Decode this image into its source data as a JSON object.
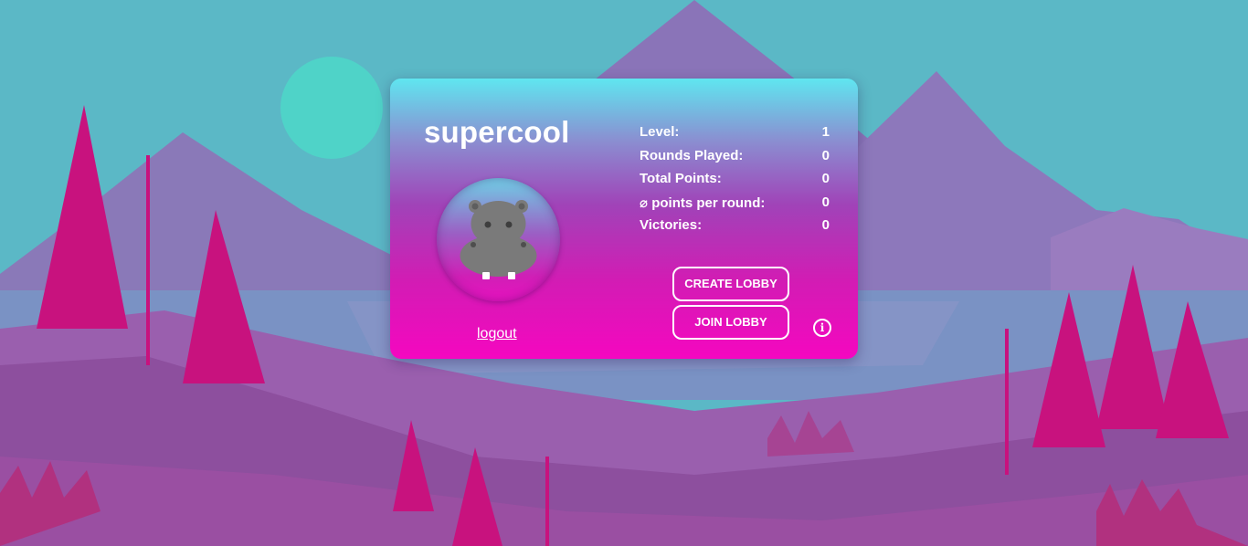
{
  "profile": {
    "username": "supercool",
    "avatar_icon": "hippo-icon",
    "logout_label": "logout"
  },
  "stats": [
    {
      "label": "Level:",
      "value": "1"
    },
    {
      "label": "Rounds Played:",
      "value": "0"
    },
    {
      "label": "Total Points:",
      "value": "0"
    },
    {
      "label": "⌀ points per round:",
      "value": "0"
    },
    {
      "label": "Victories:",
      "value": "0"
    }
  ],
  "actions": {
    "create_lobby_label": "CREATE LOBBY",
    "join_lobby_label": "JOIN LOBBY",
    "info_icon": "info-icon",
    "info_glyph": "i"
  },
  "colors": {
    "sky": "#5bb8c6",
    "sun": "#4fd3c8",
    "mountain": "#7e7ab9",
    "trees": "#c8127e",
    "ground": "#8d4f9e",
    "card_top": "#5fe6f0",
    "card_bottom": "#f507c0"
  }
}
